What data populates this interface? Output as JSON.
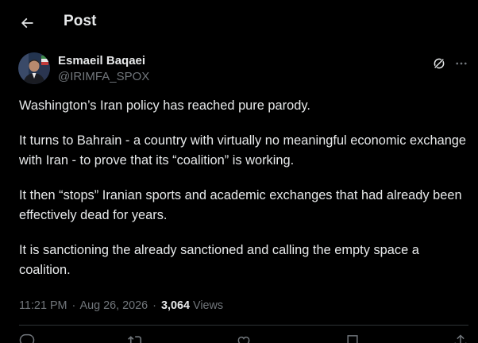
{
  "header": {
    "title": "Post"
  },
  "author": {
    "name": "Esmaeil Baqaei",
    "handle": "@IRIMFA_SPOX"
  },
  "tweet": {
    "paragraphs": [
      "Washington’s Iran policy has reached pure parody.",
      "It turns to Bahrain - a country with virtually no meaningful economic exchange with Iran - to prove that its “coalition” is working.",
      "It then “stops” Iranian sports and academic exchanges that had already been effectively dead for years.",
      "It is sanctioning the already sanctioned and calling the empty space a coalition."
    ]
  },
  "meta": {
    "time": "11:21 PM",
    "date": "Aug 26, 2026",
    "separator": "·",
    "views_count": "3,064",
    "views_label": "Views"
  },
  "icons": {
    "back": "arrow-left-icon",
    "grok": "grok-icon",
    "more": "more-horizontal-icon",
    "actions": [
      "reply-icon",
      "repost-icon",
      "like-icon",
      "bookmark-icon",
      "share-icon"
    ]
  },
  "colors": {
    "background": "#000000",
    "text_primary": "#e7e9ea",
    "text_secondary": "#71767b",
    "divider": "#2f3336"
  }
}
